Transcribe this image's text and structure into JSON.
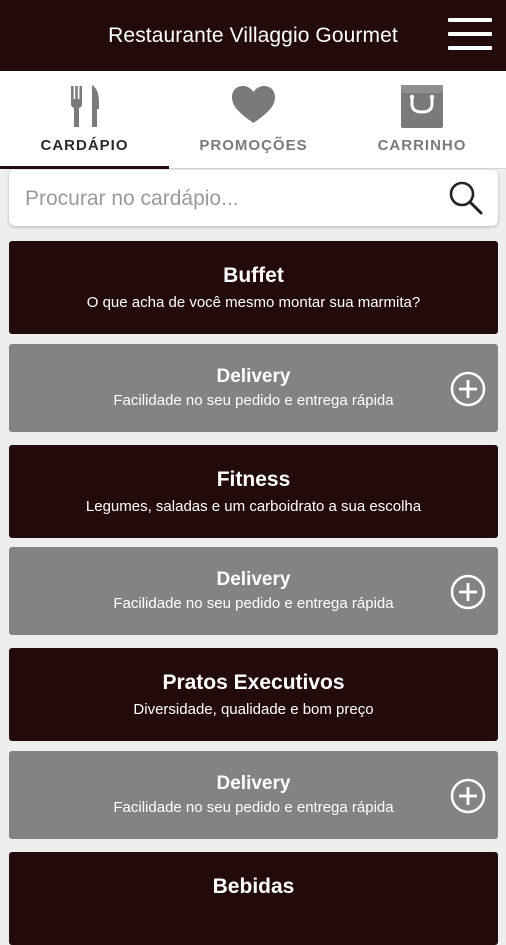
{
  "header": {
    "title": "Restaurante Villaggio Gourmet"
  },
  "tabs": [
    {
      "label": "CARDÁPIO",
      "icon": "fork-knife-icon",
      "active": true
    },
    {
      "label": "PROMOÇÕES",
      "icon": "heart-icon",
      "active": false
    },
    {
      "label": "CARRINHO",
      "icon": "shopping-bag-icon",
      "active": false
    }
  ],
  "search": {
    "placeholder": "Procurar no cardápio..."
  },
  "categories": [
    {
      "title": "Buffet",
      "subtitle": "O que acha de você mesmo montar sua marmita?"
    },
    {
      "title": "Delivery",
      "subtitle": "Facilidade no seu pedido e entrega rápida"
    },
    {
      "title": "Fitness",
      "subtitle": "Legumes, saladas e um carboidrato a sua escolha"
    },
    {
      "title": "Delivery",
      "subtitle": "Facilidade no seu pedido e entrega rápida"
    },
    {
      "title": "Pratos Executivos",
      "subtitle": "Diversidade, qualidade e bom preço"
    },
    {
      "title": "Delivery",
      "subtitle": "Facilidade no seu pedido e entrega rápida"
    },
    {
      "title": "Bebidas",
      "subtitle": ""
    }
  ],
  "colors": {
    "primary": "#230a0b",
    "secondary": "#838383",
    "background": "#eeeeee"
  }
}
